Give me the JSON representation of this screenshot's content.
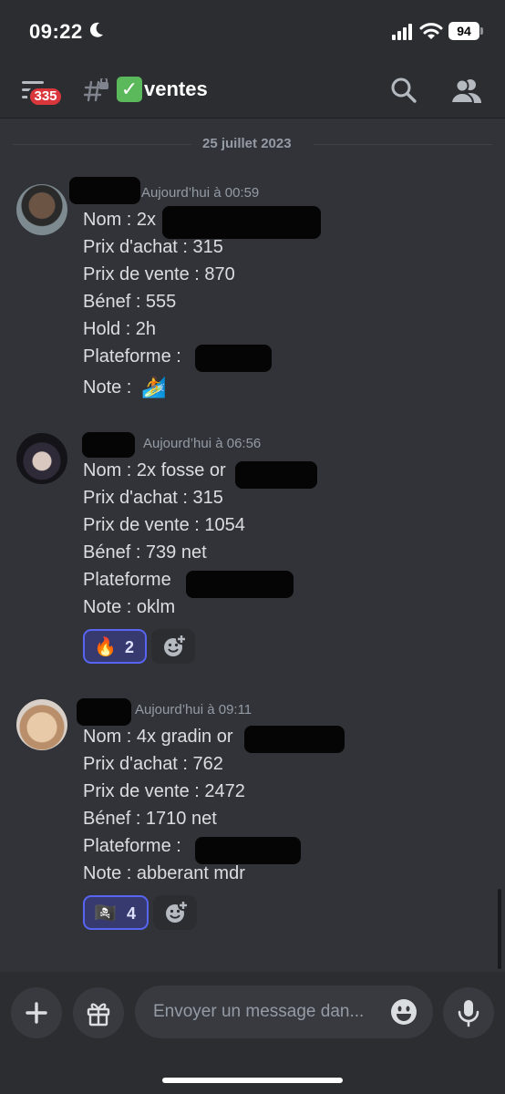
{
  "status_bar": {
    "time": "09:22",
    "battery": "94"
  },
  "header": {
    "badge_count": "335",
    "channel_emoji": "✓",
    "channel_name": "ventes"
  },
  "date_divider": "25 juillet 2023",
  "messages": [
    {
      "timestamp": "Aujourd’hui à 00:59",
      "lines": [
        "Nom : 2x",
        "Prix d'achat : 315",
        "Prix de vente : 870",
        "Bénef : 555",
        "Hold : 2h",
        "Plateforme :",
        "Note :"
      ],
      "note_emoji": "🏄"
    },
    {
      "timestamp": "Aujourd’hui à 06:56",
      "lines": [
        "Nom : 2x fosse or",
        "Prix d'achat : 315",
        "Prix de vente : 1054",
        "Bénef : 739 net",
        "Plateforme",
        "Note : oklm"
      ],
      "reaction": {
        "emoji": "🔥",
        "count": "2"
      }
    },
    {
      "timestamp": "Aujourd’hui à 09:11",
      "lines": [
        "Nom : 4x gradin or",
        "Prix d'achat : 762",
        "Prix de vente : 2472",
        "Bénef :  1710 net",
        "Plateforme :",
        "Note : abberant mdr"
      ],
      "reaction": {
        "emoji": "🏴‍☠️",
        "count": "4"
      }
    }
  ],
  "composer": {
    "placeholder": "Envoyer un message dan..."
  },
  "icons": {
    "status": [
      "moon-icon",
      "signal-icon",
      "wifi-icon",
      "battery-icon"
    ],
    "header": [
      "menu-icon",
      "channel-locked-icon",
      "search-icon",
      "members-icon"
    ],
    "composer": [
      "plus-icon",
      "gift-icon",
      "emoji-icon",
      "microphone-icon"
    ],
    "reactions": [
      "add-reaction-icon"
    ]
  },
  "colors": {
    "background": "#313338",
    "header": "#2b2d31",
    "badge": "#da373c",
    "reaction_active": "#5865f2",
    "text": "#dbdee1",
    "muted": "#949ba4"
  }
}
